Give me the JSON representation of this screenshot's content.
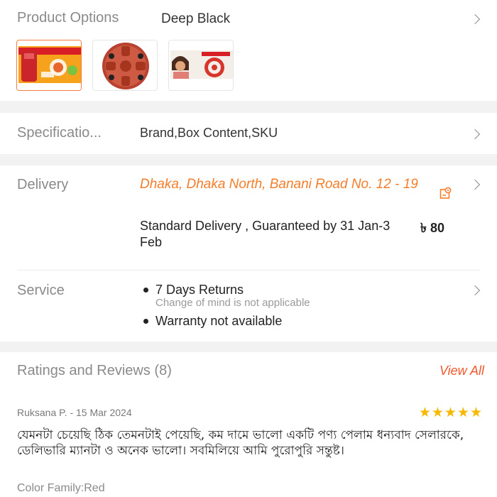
{
  "product_options": {
    "label": "Product Options",
    "value": "Deep Black",
    "thumbnails": [
      {
        "name": "thumb-product-box",
        "selected": true
      },
      {
        "name": "thumb-red-gadget",
        "selected": false
      },
      {
        "name": "thumb-model-with-product",
        "selected": false
      }
    ]
  },
  "specifications": {
    "label": "Specificatio...",
    "value": "Brand,Box Content,SKU"
  },
  "delivery": {
    "label": "Delivery",
    "address": "Dhaka, Dhaka North, Banani Road No. 12 - 19",
    "option": "Standard Delivery , Guaranteed by 31 Jan-3 Feb",
    "price": "৳ 80"
  },
  "service": {
    "label": "Service",
    "items": [
      {
        "title": "7 Days Returns",
        "subtitle": "Change of mind is not applicable"
      },
      {
        "title": "Warranty not available"
      }
    ]
  },
  "ratings": {
    "title": "Ratings and Reviews (8)",
    "view_all": "View All",
    "review": {
      "author_date": "Ruksana P. - 15 Mar 2024",
      "stars": 5,
      "stars_text": "★★★★★",
      "text": "যেমনটা চেয়েছি ঠিক তেমনটাই পেয়েছি, কম দামে ভালো একটি পণ্য পেলাম ধন্যবাদ সেলারকে, ডেলিভারি ম্যানটা ও অনেক ভালো। সবমিলিয়ে আমি পুরোপুরি সন্তুষ্ট।",
      "variant": "Color Family:Red"
    }
  },
  "colors": {
    "accent": "#f57d29",
    "view_all": "#f0592e",
    "star": "#f6b800",
    "muted": "#8a8a8a"
  }
}
